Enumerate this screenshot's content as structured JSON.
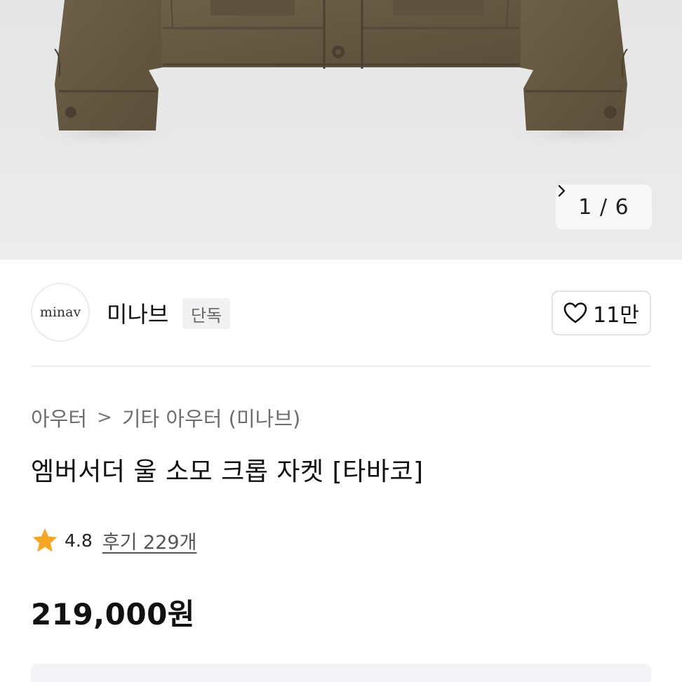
{
  "gallery": {
    "current": "1",
    "separator": "/",
    "total": "6",
    "next_icon": "chevron-right-icon"
  },
  "brand": {
    "logo_text": "minav",
    "name": "미나브",
    "badge": "단독"
  },
  "like": {
    "icon": "heart-outline-icon",
    "count": "11만"
  },
  "breadcrumb": {
    "items": [
      "아우터",
      "기타 아우터 (미나브)"
    ],
    "separator": ">"
  },
  "product": {
    "title": "엠버서더 울 소모 크롭 자켓 [타바코]",
    "rating": "4.8",
    "reviews": "후기 229개",
    "price": "219,000원"
  },
  "colors": {
    "star": "#f5a623",
    "jacket": "#6a5d45",
    "background": "#e8e8e8"
  }
}
